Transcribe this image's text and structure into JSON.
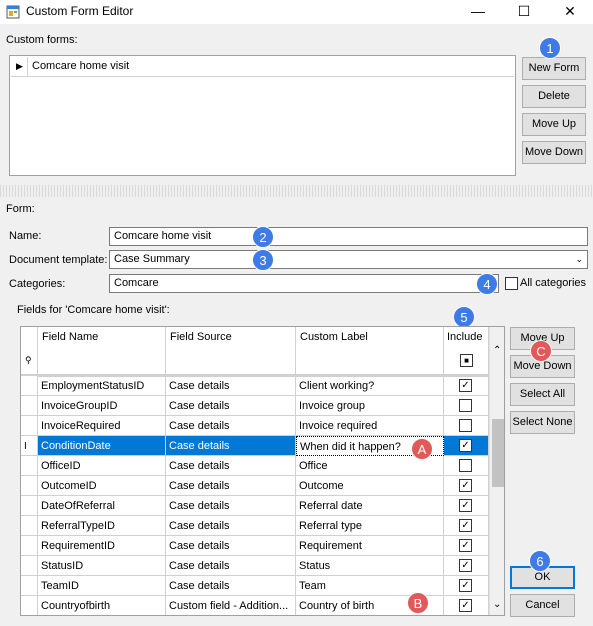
{
  "window": {
    "title": "Custom Form Editor",
    "minimize": "—",
    "maximize": "☐",
    "close": "✕"
  },
  "custom_forms": {
    "label": "Custom forms:",
    "items": [
      "Comcare home visit"
    ],
    "buttons": {
      "new_form": "New Form",
      "delete": "Delete",
      "move_up": "Move Up",
      "move_down": "Move Down"
    }
  },
  "form": {
    "label": "Form:",
    "name_label": "Name:",
    "name_value": "Comcare home visit",
    "template_label": "Document template:",
    "template_value": "Case Summary",
    "categories_label": "Categories:",
    "categories_value": "Comcare",
    "all_categories_label": "All categories"
  },
  "fields": {
    "label": "Fields for 'Comcare home visit':",
    "columns": {
      "field_name": "Field Name",
      "field_source": "Field Source",
      "custom_label": "Custom Label",
      "include": "Include"
    },
    "rows": [
      {
        "name": "EmploymentStatusID",
        "source": "Case details",
        "label": "Client working?",
        "include": true
      },
      {
        "name": "InvoiceGroupID",
        "source": "Case details",
        "label": "Invoice group",
        "include": false
      },
      {
        "name": "InvoiceRequired",
        "source": "Case details",
        "label": "Invoice required",
        "include": false
      },
      {
        "name": "ConditionDate",
        "source": "Case details",
        "label": "When did it happen?",
        "include": true,
        "selected": true
      },
      {
        "name": "OfficeID",
        "source": "Case details",
        "label": "Office",
        "include": false
      },
      {
        "name": "OutcomeID",
        "source": "Case details",
        "label": "Outcome",
        "include": true
      },
      {
        "name": "DateOfReferral",
        "source": "Case details",
        "label": "Referral date",
        "include": true
      },
      {
        "name": "ReferralTypeID",
        "source": "Case details",
        "label": "Referral type",
        "include": true
      },
      {
        "name": "RequirementID",
        "source": "Case details",
        "label": "Requirement",
        "include": true
      },
      {
        "name": "StatusID",
        "source": "Case details",
        "label": "Status",
        "include": true
      },
      {
        "name": "TeamID",
        "source": "Case details",
        "label": "Team",
        "include": true
      },
      {
        "name": "Countryofbirth",
        "source": "Custom field - Addition...",
        "label": "Country of birth",
        "include": true
      }
    ],
    "buttons": {
      "move_up": "Move Up",
      "move_down": "Move Down",
      "select_all": "Select All",
      "select_none": "Select None",
      "ok": "OK",
      "cancel": "Cancel"
    }
  },
  "badges": {
    "b1": "1",
    "b2": "2",
    "b3": "3",
    "b4": "4",
    "b5": "5",
    "b6": "6",
    "bA": "A",
    "bB": "B",
    "bC": "C"
  },
  "colors": {
    "selection": "#0078d7",
    "badge_blue": "#3f7be6",
    "badge_red": "#e05a5a"
  }
}
